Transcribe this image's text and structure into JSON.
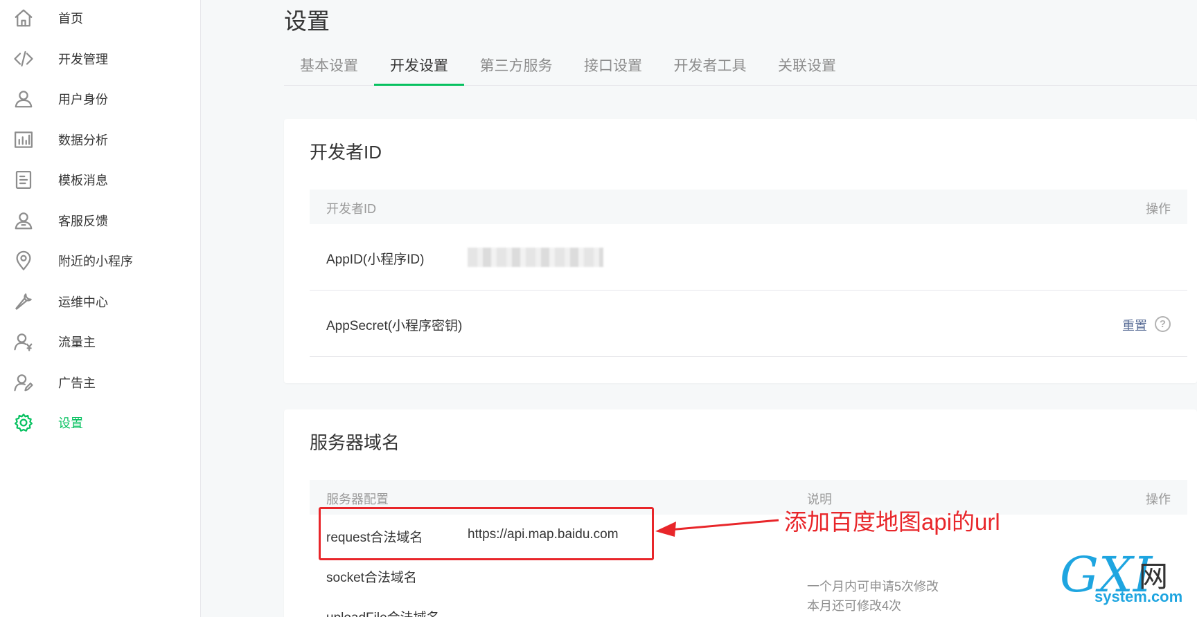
{
  "sidebar": {
    "items": [
      {
        "label": "首页",
        "icon": "home-icon",
        "active": false
      },
      {
        "label": "开发管理",
        "icon": "code-icon",
        "active": false
      },
      {
        "label": "用户身份",
        "icon": "user-icon",
        "active": false
      },
      {
        "label": "数据分析",
        "icon": "bar-chart-icon",
        "active": false
      },
      {
        "label": "模板消息",
        "icon": "document-icon",
        "active": false
      },
      {
        "label": "客服反馈",
        "icon": "support-user-icon",
        "active": false
      },
      {
        "label": "附近的小程序",
        "icon": "location-pin-icon",
        "active": false
      },
      {
        "label": "运维中心",
        "icon": "wrench-icon",
        "active": false
      },
      {
        "label": "流量主",
        "icon": "user-yen-icon",
        "active": false
      },
      {
        "label": "广告主",
        "icon": "user-edit-icon",
        "active": false
      },
      {
        "label": "设置",
        "icon": "gear-icon",
        "active": true
      }
    ]
  },
  "page": {
    "title": "设置",
    "tabs": [
      {
        "label": "基本设置",
        "active": false
      },
      {
        "label": "开发设置",
        "active": true
      },
      {
        "label": "第三方服务",
        "active": false
      },
      {
        "label": "接口设置",
        "active": false
      },
      {
        "label": "开发者工具",
        "active": false
      },
      {
        "label": "关联设置",
        "active": false
      }
    ]
  },
  "developer_id": {
    "title": "开发者ID",
    "header": {
      "col1": "开发者ID",
      "action": "操作"
    },
    "rows": [
      {
        "label": "AppID(小程序ID)",
        "value": ""
      },
      {
        "label": "AppSecret(小程序密钥)",
        "action": "重置",
        "help": "?"
      }
    ]
  },
  "server_domain": {
    "title": "服务器域名",
    "header": {
      "col1": "服务器配置",
      "col2": "说明",
      "action": "操作"
    },
    "rows": [
      {
        "label": "request合法域名",
        "value": "https://api.map.baidu.com"
      },
      {
        "label": "socket合法域名",
        "value": ""
      },
      {
        "label": "uploadFile合法域名",
        "value": ""
      }
    ],
    "notes": [
      "一个月内可申请5次修改",
      "本月还可修改4次"
    ]
  },
  "annotation": {
    "text": "添加百度地图api的url",
    "color": "#e8262a"
  },
  "watermark": {
    "letters": "GXI",
    "cn": "网",
    "domain": "system.com"
  },
  "colors": {
    "accent": "#07c160",
    "link": "#576b95",
    "annotation": "#e8262a"
  }
}
